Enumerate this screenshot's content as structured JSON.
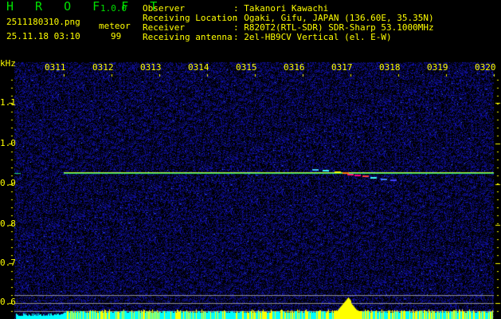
{
  "header": {
    "app_name": "H R O F F T",
    "version": "1.0.0",
    "filename": "2511180310.png",
    "datetime": "25.11.18 03:10",
    "meteor_label": "meteor",
    "meteor_count": "99"
  },
  "info": [
    {
      "label": "Observer",
      "value": ": Takanori Kawachi"
    },
    {
      "label": "Receiving Location",
      "value": ": Ogaki, Gifu, JAPAN (136.60E, 35.35N)"
    },
    {
      "label": "Receiver",
      "value": ": R820T2(RTL-SDR) SDR-Sharp 53.1000MHz"
    },
    {
      "label": "Receiving antenna",
      "value": ": 2el-HB9CV Vertical (el. E-W)"
    }
  ],
  "axes": {
    "y_unit": "kHz",
    "y_ticks": [
      "1.1",
      "1.0",
      "0.9",
      "0.8",
      "0.7",
      "0.6"
    ],
    "x_ticks": [
      "0311",
      "0312",
      "0313",
      "0314",
      "0315",
      "0316",
      "0317",
      "0318",
      "0319",
      "0320"
    ]
  },
  "colors": {
    "text": "#ffff00",
    "title": "#00e000",
    "noise": "#1a1aa0",
    "carrier": "#00ff80",
    "histogram_base": "#00ffff",
    "histogram_peak": "#ffff00"
  }
}
